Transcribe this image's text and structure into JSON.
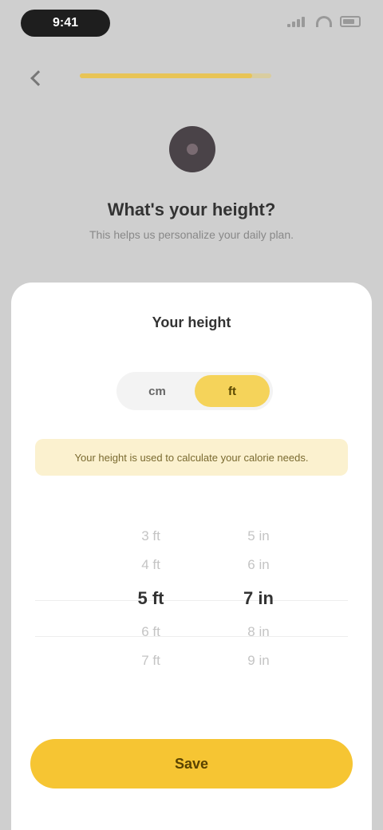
{
  "status_bar": {
    "time": "9:41"
  },
  "header": {
    "progress": 0.9,
    "title": "What's your height?",
    "subtitle": "This helps us personalize your daily plan."
  },
  "sheet": {
    "title": "Your height",
    "units": [
      {
        "label": "cm",
        "active": false
      },
      {
        "label": "ft",
        "active": true
      }
    ],
    "note": "Your height is used to calculate your calorie needs.",
    "picker": {
      "feet": [
        "3 ft",
        "4 ft",
        "5 ft",
        "6 ft",
        "7 ft"
      ],
      "feet_selected_index": 2,
      "inches": [
        "5 in",
        "6 in",
        "7 in",
        "8 in",
        "9 in"
      ],
      "inches_selected_index": 2
    },
    "confirm_label": "Save"
  },
  "colors": {
    "accent": "#f6c533",
    "toggle_active": "#f5d35a",
    "banner": "#fbf1cf"
  }
}
